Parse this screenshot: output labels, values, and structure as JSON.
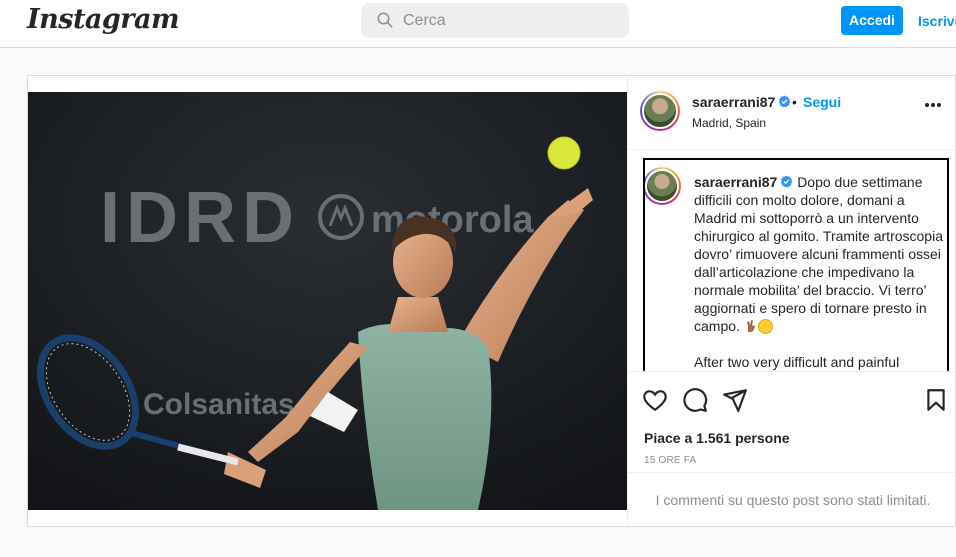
{
  "header": {
    "logo_text": "Instagram",
    "search_placeholder": "Cerca",
    "login_label": "Accedi",
    "signup_label": "Iscriviti"
  },
  "photo": {
    "banner_brand_1": "IDRD",
    "banner_brand_2": "motorola",
    "banner_brand_3": "Colsanitas"
  },
  "post": {
    "username": "saraerrani87",
    "verified": true,
    "dot": "•",
    "follow_label": "Segui",
    "location": "Madrid, Spain",
    "caption_username": "saraerrani87",
    "caption_it": "Dopo due settimane difficili con molto dolore, domani a Madrid mi sottoporrò a un intervento chirurgico al gomito. Tramite artroscopia dovro’ rimuovere alcuni frammenti ossei dall’articolazione che impedivano la normale mobilita’ del braccio. Vi terro’ aggiornati e spero di tornare presto in campo.",
    "caption_en": "After two very difficult and painful",
    "likes_text": "Piace a 1.561 persone",
    "time_text": "15 ORE FA",
    "comments_limited": "I commenti su questo post sono stati limitati."
  },
  "colors": {
    "accent": "#0095f6",
    "text": "#262626",
    "muted": "#8e8e8e",
    "border": "#dbdbdb"
  },
  "icons": [
    "search-icon",
    "verified-badge-icon",
    "more-options-icon",
    "heart-icon",
    "comment-icon",
    "share-icon",
    "bookmark-icon"
  ]
}
